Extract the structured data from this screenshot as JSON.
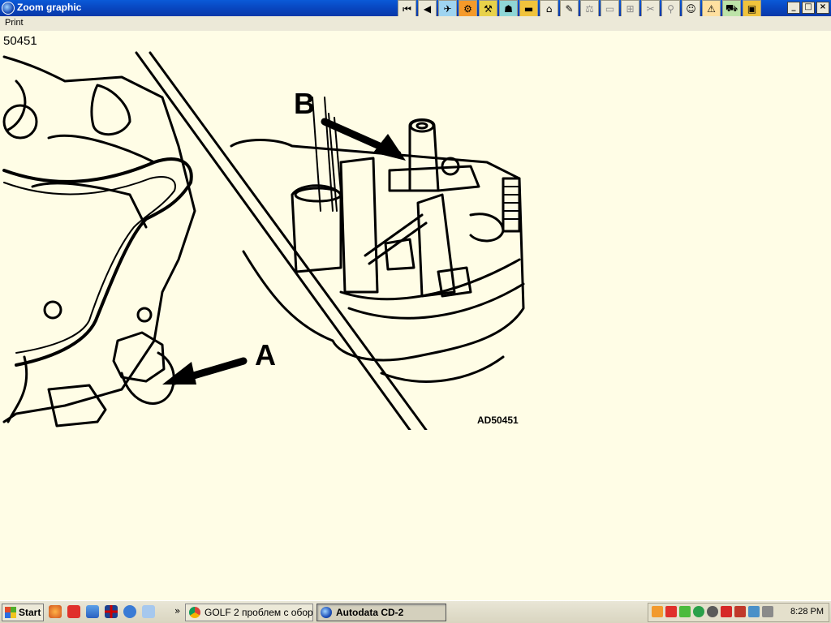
{
  "window": {
    "title": "Zoom graphic"
  },
  "menu": {
    "print_label": "Print"
  },
  "toolbar": {
    "buttons": [
      {
        "name": "first-page-button",
        "glyph": "⏮"
      },
      {
        "name": "previous-button",
        "glyph": "◀"
      },
      {
        "name": "tool-1-button",
        "glyph": "✈"
      },
      {
        "name": "tool-2-button",
        "glyph": "⚙"
      },
      {
        "name": "tool-3-button",
        "glyph": "⚒"
      },
      {
        "name": "tool-4-button",
        "glyph": "☗"
      },
      {
        "name": "tool-5-button",
        "glyph": "▬"
      },
      {
        "name": "tool-6-button",
        "glyph": "⌂"
      },
      {
        "name": "tool-7-button",
        "glyph": "✎"
      },
      {
        "name": "tool-8-button",
        "glyph": "⚖"
      },
      {
        "name": "tool-9-button",
        "glyph": "▭"
      },
      {
        "name": "tool-10-button",
        "glyph": "⊞"
      },
      {
        "name": "tool-11-button",
        "glyph": "✂"
      },
      {
        "name": "tool-12-button",
        "glyph": "⚲"
      },
      {
        "name": "tool-13-button",
        "glyph": "☺"
      },
      {
        "name": "tool-14-button",
        "glyph": "⚠"
      },
      {
        "name": "tool-15-button",
        "glyph": "⛟"
      },
      {
        "name": "tool-16-button",
        "glyph": "▣"
      }
    ]
  },
  "window_controls": {
    "minimize": "_",
    "maximize": "□",
    "close": "×"
  },
  "content": {
    "diagram_id": "50451",
    "label_a": "A",
    "label_b": "B",
    "figure_ref": "AD50451"
  },
  "taskbar": {
    "start_label": "Start",
    "chevron": "»",
    "tasks": [
      {
        "label": "GOLF 2 проблем с обор...",
        "active": false
      },
      {
        "label": "Autodata CD-2",
        "active": true
      }
    ],
    "clock": "8:28 PM"
  }
}
